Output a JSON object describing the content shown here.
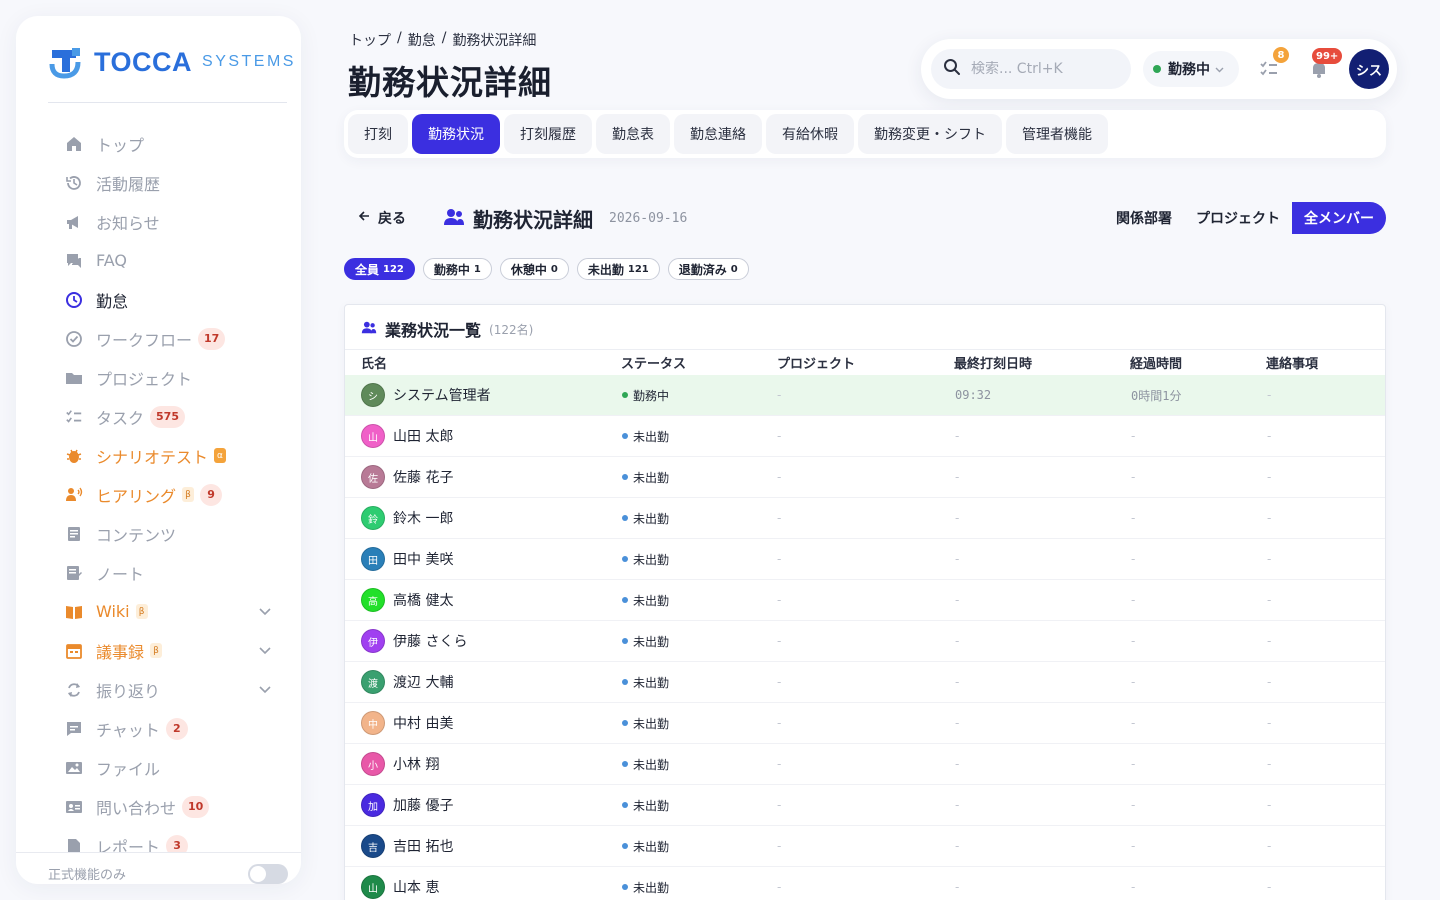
{
  "brand": {
    "name": "TOCCA",
    "sub": "SYSTEMS"
  },
  "sidebar": {
    "items": [
      {
        "label": "トップ",
        "icon": "home-icon",
        "state": "normal"
      },
      {
        "label": "活動履歴",
        "icon": "history-icon",
        "state": "normal"
      },
      {
        "label": "お知らせ",
        "icon": "megaphone-icon",
        "state": "normal"
      },
      {
        "label": "FAQ",
        "icon": "faq-chat-icon",
        "state": "normal"
      },
      {
        "label": "勤怠",
        "icon": "clock-icon",
        "state": "active"
      },
      {
        "label": "ワークフロー",
        "icon": "check-circle-icon",
        "state": "normal",
        "badge": "17"
      },
      {
        "label": "プロジェクト",
        "icon": "folder-icon",
        "state": "normal"
      },
      {
        "label": "タスク",
        "icon": "checklist-icon",
        "state": "normal",
        "badge": "575"
      },
      {
        "label": "シナリオテスト",
        "icon": "bug-icon",
        "state": "orange",
        "tag": "α"
      },
      {
        "label": "ヒアリング",
        "icon": "interview-icon",
        "state": "orange",
        "tag": "β",
        "badge": "9"
      },
      {
        "label": "コンテンツ",
        "icon": "document-icon",
        "state": "normal"
      },
      {
        "label": "ノート",
        "icon": "note-icon",
        "state": "normal"
      },
      {
        "label": "Wiki",
        "icon": "book-icon",
        "state": "orange",
        "tag": "β",
        "chevron": true
      },
      {
        "label": "議事録",
        "icon": "calendar-icon",
        "state": "orange",
        "tag": "β",
        "chevron": true
      },
      {
        "label": "振り返り",
        "icon": "refresh-icon",
        "state": "normal",
        "chevron": true
      },
      {
        "label": "チャット",
        "icon": "chat-icon",
        "state": "normal",
        "badge": "2"
      },
      {
        "label": "ファイル",
        "icon": "image-icon",
        "state": "normal"
      },
      {
        "label": "問い合わせ",
        "icon": "contact-card-icon",
        "state": "normal",
        "badge": "10"
      },
      {
        "label": "レポート",
        "icon": "report-icon",
        "state": "normal",
        "badge": "3"
      }
    ],
    "footer_label": "正式機能のみ"
  },
  "breadcrumb": [
    "トップ",
    "勤怠",
    "勤務状況詳細"
  ],
  "page_title": "勤務状況詳細",
  "topbar": {
    "search_placeholder": "検索... Ctrl+K",
    "status": "勤務中",
    "tasks_badge": "8",
    "notifications_badge": "99+",
    "avatar": "シス"
  },
  "tabs": [
    "打刻",
    "勤務状況",
    "打刻履歴",
    "勤怠表",
    "勤怠連絡",
    "有給休暇",
    "勤務変更・シフト",
    "管理者機能"
  ],
  "active_tab": 1,
  "detail": {
    "back_label": "戻る",
    "title": "勤務状況詳細",
    "date": "2026-09-16",
    "scopes": [
      "関係部署",
      "プロジェクト",
      "全メンバー"
    ],
    "active_scope": 2
  },
  "filters": [
    {
      "label": "全員",
      "count": "122",
      "active": true
    },
    {
      "label": "勤務中",
      "count": "1",
      "active": false
    },
    {
      "label": "休憩中",
      "count": "0",
      "active": false
    },
    {
      "label": "未出勤",
      "count": "121",
      "active": false
    },
    {
      "label": "退勤済み",
      "count": "0",
      "active": false
    }
  ],
  "table": {
    "title": "業務状況一覧",
    "count": "(122名)",
    "columns": [
      "氏名",
      "ステータス",
      "プロジェクト",
      "最終打刻日時",
      "経過時間",
      "連絡事項"
    ],
    "rows": [
      {
        "initial": "シ",
        "name": "システム管理者",
        "status": "勤務中",
        "status_color": "#2fa655",
        "avatar_color": "#5f8a5a",
        "project": "-",
        "last_punch": "09:32",
        "elapsed": "0時間1分",
        "note": "-",
        "highlight": true
      },
      {
        "initial": "山",
        "name": "山田 太郎",
        "status": "未出勤",
        "status_color": "#4a90d9",
        "avatar_color": "#f060c8",
        "project": "-",
        "last_punch": "-",
        "elapsed": "-",
        "note": "-"
      },
      {
        "initial": "佐",
        "name": "佐藤 花子",
        "status": "未出勤",
        "status_color": "#4a90d9",
        "avatar_color": "#b87a96",
        "project": "-",
        "last_punch": "-",
        "elapsed": "-",
        "note": "-"
      },
      {
        "initial": "鈴",
        "name": "鈴木 一郎",
        "status": "未出勤",
        "status_color": "#4a90d9",
        "avatar_color": "#2ecc71",
        "project": "-",
        "last_punch": "-",
        "elapsed": "-",
        "note": "-"
      },
      {
        "initial": "田",
        "name": "田中 美咲",
        "status": "未出勤",
        "status_color": "#4a90d9",
        "avatar_color": "#2a7fb8",
        "project": "-",
        "last_punch": "-",
        "elapsed": "-",
        "note": "-"
      },
      {
        "initial": "高",
        "name": "高橋 健太",
        "status": "未出勤",
        "status_color": "#4a90d9",
        "avatar_color": "#22e02a",
        "project": "-",
        "last_punch": "-",
        "elapsed": "-",
        "note": "-"
      },
      {
        "initial": "伊",
        "name": "伊藤 さくら",
        "status": "未出勤",
        "status_color": "#4a90d9",
        "avatar_color": "#a040f0",
        "project": "-",
        "last_punch": "-",
        "elapsed": "-",
        "note": "-"
      },
      {
        "initial": "渡",
        "name": "渡辺 大輔",
        "status": "未出勤",
        "status_color": "#4a90d9",
        "avatar_color": "#3aa070",
        "project": "-",
        "last_punch": "-",
        "elapsed": "-",
        "note": "-"
      },
      {
        "initial": "中",
        "name": "中村 由美",
        "status": "未出勤",
        "status_color": "#4a90d9",
        "avatar_color": "#f2b48a",
        "project": "-",
        "last_punch": "-",
        "elapsed": "-",
        "note": "-"
      },
      {
        "initial": "小",
        "name": "小林 翔",
        "status": "未出勤",
        "status_color": "#4a90d9",
        "avatar_color": "#e858a8",
        "project": "-",
        "last_punch": "-",
        "elapsed": "-",
        "note": "-"
      },
      {
        "initial": "加",
        "name": "加藤 優子",
        "status": "未出勤",
        "status_color": "#4a90d9",
        "avatar_color": "#4a2ae0",
        "project": "-",
        "last_punch": "-",
        "elapsed": "-",
        "note": "-"
      },
      {
        "initial": "吉",
        "name": "吉田 拓也",
        "status": "未出勤",
        "status_color": "#4a90d9",
        "avatar_color": "#1a4a8a",
        "project": "-",
        "last_punch": "-",
        "elapsed": "-",
        "note": "-"
      },
      {
        "initial": "山",
        "name": "山本 恵",
        "status": "未出勤",
        "status_color": "#4a90d9",
        "avatar_color": "#1f8a4a",
        "project": "-",
        "last_punch": "-",
        "elapsed": "-",
        "note": "-"
      }
    ]
  },
  "colors": {
    "accent": "#3b2fe0",
    "brand": "#2a6fdb",
    "orange": "#ea8a2c",
    "working": "#2fa655",
    "absent": "#4a90d9"
  }
}
